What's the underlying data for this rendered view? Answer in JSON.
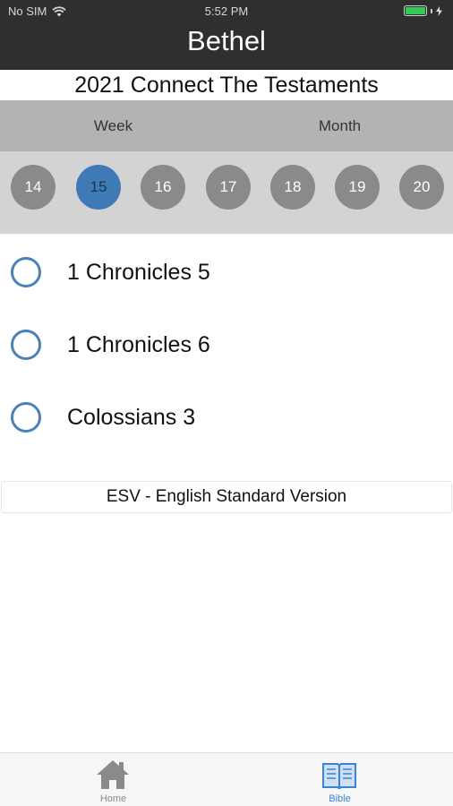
{
  "status_bar": {
    "carrier": "No SIM",
    "time": "5:52 PM"
  },
  "header": {
    "title": "Bethel"
  },
  "plan": {
    "title": "2021 Connect The Testaments"
  },
  "segments": {
    "week_label": "Week",
    "month_label": "Month"
  },
  "days": {
    "items": [
      "14",
      "15",
      "16",
      "17",
      "18",
      "19",
      "20"
    ],
    "selected": "15"
  },
  "readings": [
    {
      "label": "1 Chronicles 5",
      "checked": false
    },
    {
      "label": "1 Chronicles 6",
      "checked": false
    },
    {
      "label": "Colossians 3",
      "checked": false
    }
  ],
  "version": {
    "label": "ESV - English Standard Version"
  },
  "tab_bar": {
    "home_label": "Home",
    "bible_label": "Bible",
    "active": "Bible"
  },
  "colors": {
    "header_bg": "#2f2f2f",
    "accent": "#3f7ab6",
    "radio_border": "#4a82b8",
    "day_bg": "#8a8a8a",
    "tab_active": "#3b82d4"
  }
}
